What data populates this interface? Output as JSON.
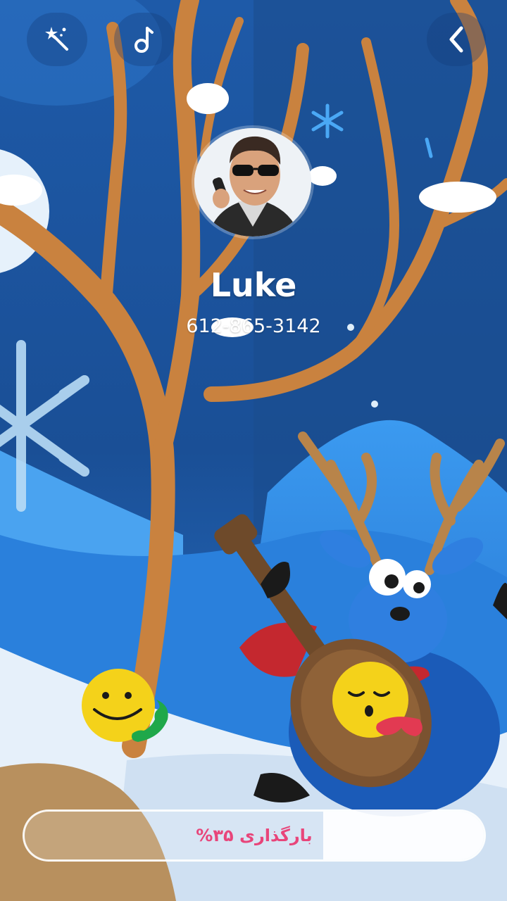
{
  "caller": {
    "name": "Luke",
    "phone": "612-865-3142"
  },
  "toolbar": {
    "icons": [
      "magic-wand-icon",
      "music-note-icon",
      "back-chevron-icon"
    ]
  },
  "actions": {
    "answer_icon": "smiley-phone-icon",
    "decline_icon": "sleepy-face-icon"
  },
  "loading": {
    "label": "بارگذاری ۳۵%",
    "progress_fraction": 0.35
  },
  "colors": {
    "accent_text": "#e8457a",
    "emoji_yellow": "#f4d21a",
    "answer_green": "#1fa84a",
    "decline_red": "#e23a52"
  }
}
